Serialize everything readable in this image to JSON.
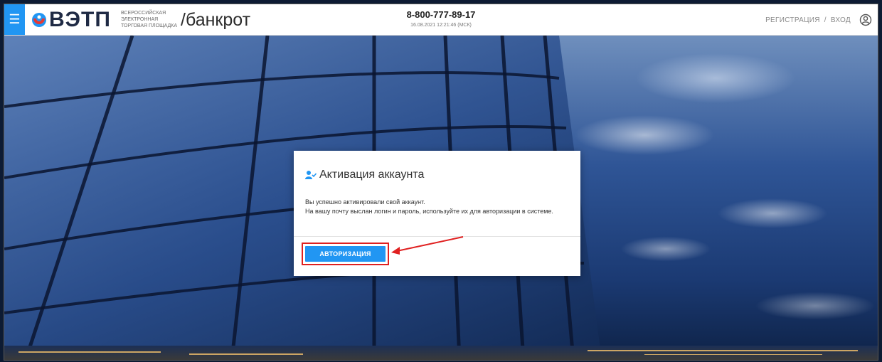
{
  "header": {
    "logo_name": "ВЭТП",
    "logo_tagline": [
      "ВСЕРОССИЙСКАЯ",
      "ЭЛЕКТРОННАЯ",
      "ТОРГОВАЯ ПЛОЩАДКА"
    ],
    "section_name": "/банкрот",
    "phone": "8-800-777-89-17",
    "datetime": "16.08.2021 12:21:46 (МСК)",
    "register_label": "РЕГИСТРАЦИЯ",
    "separator": "/",
    "login_label": "ВХОД"
  },
  "modal": {
    "title": "Активация аккаунта",
    "body": [
      "Вы успешно активировали свой аккаунт.",
      "На вашу почту выслан логин и пароль, используйте их для авторизации в системе."
    ],
    "button_label": "АВТОРИЗАЦИЯ"
  },
  "colors": {
    "accent": "#2196f3",
    "annotation": "#e02020",
    "logo_red": "#e53935"
  },
  "icons": {
    "menu": "menu-icon",
    "logo": "vetp-logo-icon",
    "user": "user-circle-icon",
    "title": "user-check-icon",
    "annotation": "arrow-annotation-icon"
  }
}
